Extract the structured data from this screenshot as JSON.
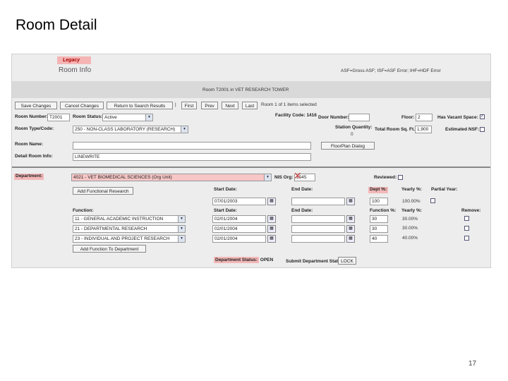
{
  "slide": {
    "title": "Room Detail",
    "page_number": "17"
  },
  "header": {
    "legacy_tag": "Legacy",
    "section_title": "Room Info",
    "legend": "ASF=Gross ASF; ISF=ASF Error; IHF=HDF Error",
    "room_heading": "Room T2001 in VET RESEARCH TOWER"
  },
  "toolbar": {
    "save": "Save Changes",
    "cancel": "Cancel Changes",
    "return": "Return to Search Results",
    "first": "First",
    "prev": "Prev",
    "next": "Next",
    "last": "Last",
    "count_text": "Room 1 of 1 items selected"
  },
  "room": {
    "room_number_label": "Room Number:",
    "room_number": "T2001",
    "room_status_label": "Room Status:",
    "room_status": "Active",
    "facility_code_label": "Facility Code:",
    "facility_code": "1416",
    "door_number_label": "Door Number:",
    "door_number": "",
    "floor_label": "Floor:",
    "floor": "2",
    "vacant_label": "Has Vacant Space:",
    "room_type_label": "Room Type/Code:",
    "room_type": "250 - NON-CLASS LABORATORY (RESEARCH)",
    "station_label": "Station Quantity:",
    "station_value": "0",
    "total_sqft_label": "Total Room Sq. Ft.:",
    "total_sqft": "1,900",
    "est_nsf_label": "Estimated NSF:",
    "room_name_label": "Room Name:",
    "room_name": "",
    "floor_plan_btn": "FloorPlan Dialog",
    "detail_info_label": "Detail Room Info:",
    "detail_info": "LINEWRITE"
  },
  "department": {
    "label": "Department:",
    "value": "4021 - VET BIOMEDICAL SCIENCES (Org Unit)",
    "nis_label": "NIS Org:",
    "nis_value": "1045",
    "reviewed_label": "Reviewed:",
    "add_research_btn": "Add Functional Research",
    "start_label": "Start Date:",
    "end_label": "End Date:",
    "dept_pct_label": "Dept %:",
    "yearly_label": "Yearly %:",
    "partial_label": "Partial Year:",
    "start_date": "07/01/2003",
    "end_date": "",
    "dept_pct": "100",
    "yearly_pct": "100.00%",
    "status_label": "Department Status:",
    "status_value": "OPEN",
    "submit_label": "Submit Department Status:",
    "submit_value": "LOCK"
  },
  "functions": {
    "function_label": "Function:",
    "start_label": "Start Date:",
    "end_label": "End Date:",
    "func_pct_label": "Function %:",
    "yearly_label": "Yearly %:",
    "remove_label": "Remove:",
    "rows": [
      {
        "name": "11 - GENERAL ACADEMIC INSTRUCTION",
        "start": "02/01/2004",
        "end": "",
        "pct": "30",
        "yearly": "30.00%"
      },
      {
        "name": "21 - DEPARTMENTAL RESEARCH",
        "start": "02/01/2004",
        "end": "",
        "pct": "30",
        "yearly": "30.00%"
      },
      {
        "name": "23 - INDIVIDUAL AND PROJECT RESEARCH",
        "start": "02/01/2004",
        "end": "",
        "pct": "40",
        "yearly": "40.00%"
      }
    ],
    "add_btn": "Add Function To Department"
  }
}
